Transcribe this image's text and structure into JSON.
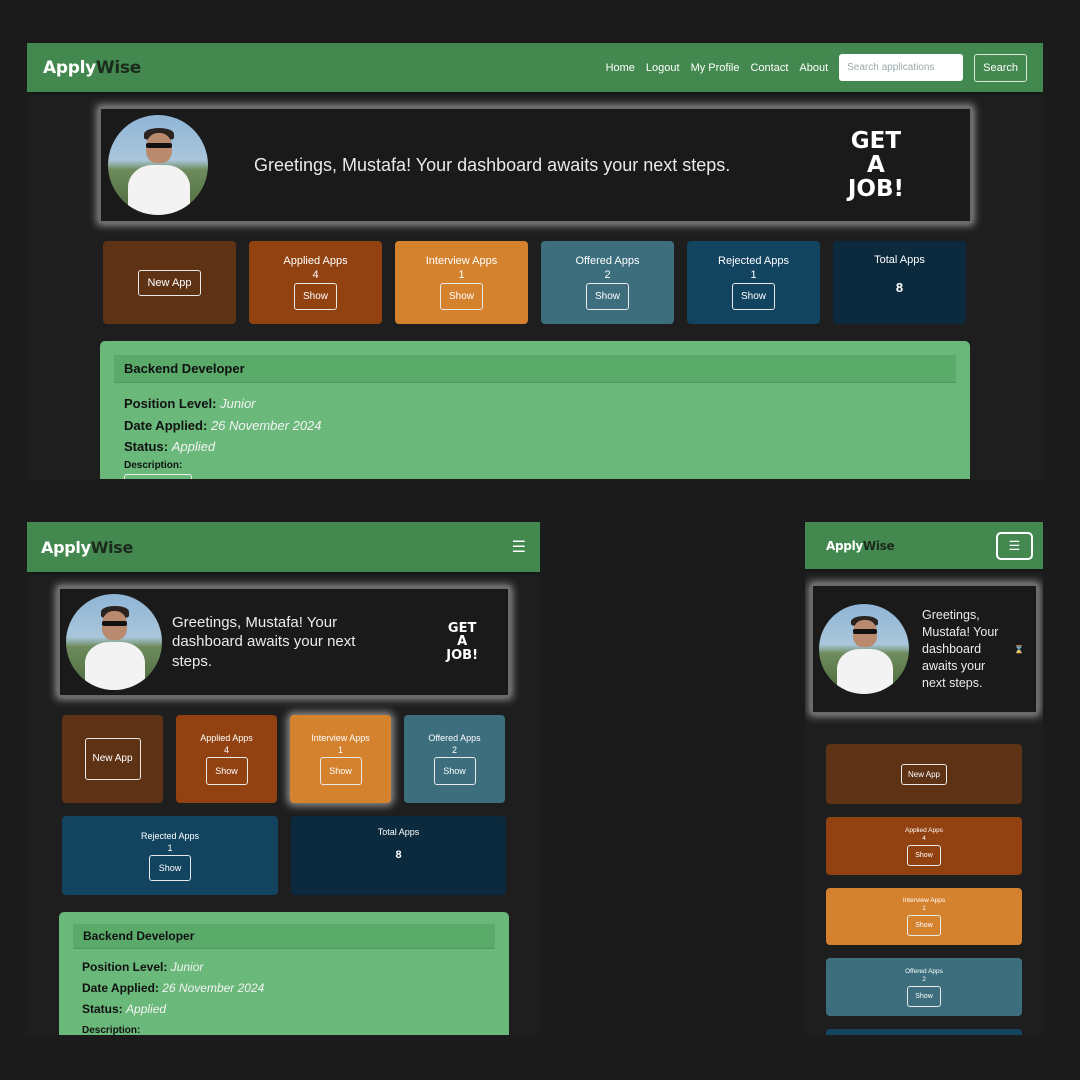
{
  "brand": {
    "part1": "Apply",
    "part2": "Wise"
  },
  "nav": {
    "links": [
      "Home",
      "Logout",
      "My Profile",
      "Contact",
      "About"
    ],
    "search_placeholder": "Search applications",
    "search_button": "Search",
    "menu_icon": "hamburger-icon"
  },
  "greeting": {
    "text": "Greetings, Mustafa! Your dashboard awaits your next steps.",
    "get_job": [
      "GET",
      "A",
      "JOB!"
    ],
    "mobile_icon": "hourglass-icon"
  },
  "stats": {
    "new_app": "New App",
    "show": "Show",
    "applied": {
      "label": "Applied Apps",
      "count": "4"
    },
    "interview": {
      "label": "Interview Apps",
      "count": "1"
    },
    "offered": {
      "label": "Offered Apps",
      "count": "2"
    },
    "rejected": {
      "label": "Rejected Apps",
      "count": "1"
    },
    "total": {
      "label": "Total Apps",
      "count": "8"
    }
  },
  "job": {
    "title": "Backend Developer",
    "position_label": "Position Level:",
    "position_value": "Junior",
    "date_label": "Date Applied:",
    "date_value": "26 November 2024",
    "status_label": "Status:",
    "status_value": "Applied",
    "description_label": "Description:"
  },
  "colors": {
    "navbar": "#43894f",
    "new_app": "#5e3215",
    "applied": "#924210",
    "interview": "#d5822f",
    "offered": "#3c6e7d",
    "rejected": "#124460",
    "total": "#0c2a3d",
    "job_card": "#6ab87a"
  }
}
